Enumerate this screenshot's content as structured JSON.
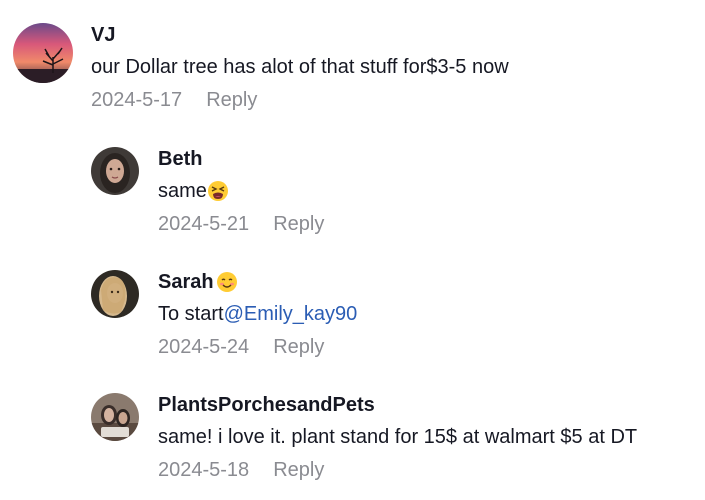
{
  "comments": [
    {
      "username": "VJ",
      "text": "our Dollar tree has alot of that stuff for$3-5 now",
      "date": "2024-5-17",
      "reply_label": "Reply",
      "replies": [
        {
          "username": "Beth",
          "text": "same",
          "text_emoji": "tired-face-emoji",
          "date": "2024-5-21",
          "reply_label": "Reply"
        },
        {
          "username": "Sarah",
          "username_emoji": "smiling-face-emoji",
          "text": "To start",
          "mention": "@Emily_kay90",
          "date": "2024-5-24",
          "reply_label": "Reply"
        },
        {
          "username": "PlantsPorchesandPets",
          "text": "same! i love it. plant stand for 15$ at walmart $5 at DT",
          "date": "2024-5-18",
          "reply_label": "Reply"
        }
      ]
    }
  ],
  "colors": {
    "text": "#161823",
    "meta": "#8a8b91",
    "mention": "#2b5db4"
  }
}
